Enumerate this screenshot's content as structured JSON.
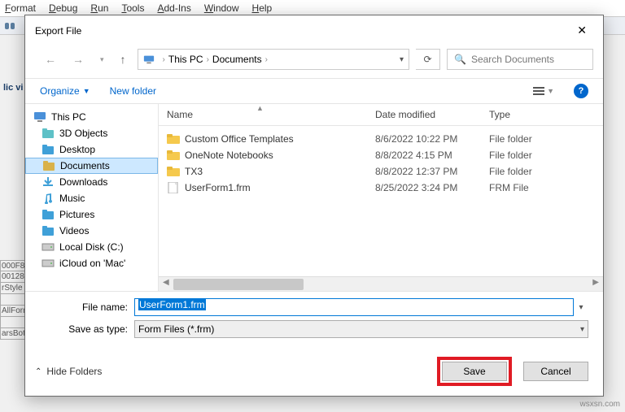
{
  "menubar": [
    "Format",
    "Debug",
    "Run",
    "Tools",
    "Add-Ins",
    "Window",
    "Help"
  ],
  "bg": {
    "label": "lic vi",
    "cells": [
      "000F8",
      "00128",
      "rStyle",
      "",
      "AllForm",
      "",
      "arsBoth"
    ]
  },
  "dialog": {
    "title": "Export File",
    "breadcrumb": {
      "root": "This PC",
      "folder": "Documents"
    },
    "search_placeholder": "Search Documents",
    "organize": "Organize",
    "newfolder": "New folder",
    "tree": [
      {
        "label": "This PC",
        "root": true,
        "icon": "pc"
      },
      {
        "label": "3D Objects",
        "icon": "3d"
      },
      {
        "label": "Desktop",
        "icon": "desktop"
      },
      {
        "label": "Documents",
        "icon": "docs",
        "selected": true
      },
      {
        "label": "Downloads",
        "icon": "downloads"
      },
      {
        "label": "Music",
        "icon": "music"
      },
      {
        "label": "Pictures",
        "icon": "pictures"
      },
      {
        "label": "Videos",
        "icon": "videos"
      },
      {
        "label": "Local Disk (C:)",
        "icon": "disk"
      },
      {
        "label": "iCloud on 'Mac'",
        "icon": "disk"
      }
    ],
    "columns": {
      "name": "Name",
      "date": "Date modified",
      "type": "Type"
    },
    "files": [
      {
        "name": "Custom Office Templates",
        "date": "8/6/2022 10:22 PM",
        "type": "File folder",
        "kind": "folder"
      },
      {
        "name": "OneNote Notebooks",
        "date": "8/8/2022 4:15 PM",
        "type": "File folder",
        "kind": "folder"
      },
      {
        "name": "TX3",
        "date": "8/8/2022 12:37 PM",
        "type": "File folder",
        "kind": "folder"
      },
      {
        "name": "UserForm1.frm",
        "date": "8/25/2022 3:24 PM",
        "type": "FRM File",
        "kind": "file"
      }
    ],
    "filename_label": "File name:",
    "filename_value": "UserForm1.frm",
    "filetype_label": "Save as type:",
    "filetype_value": "Form Files (*.frm)",
    "hide_folders": "Hide Folders",
    "save": "Save",
    "cancel": "Cancel"
  },
  "watermark": "wsxsn.com"
}
